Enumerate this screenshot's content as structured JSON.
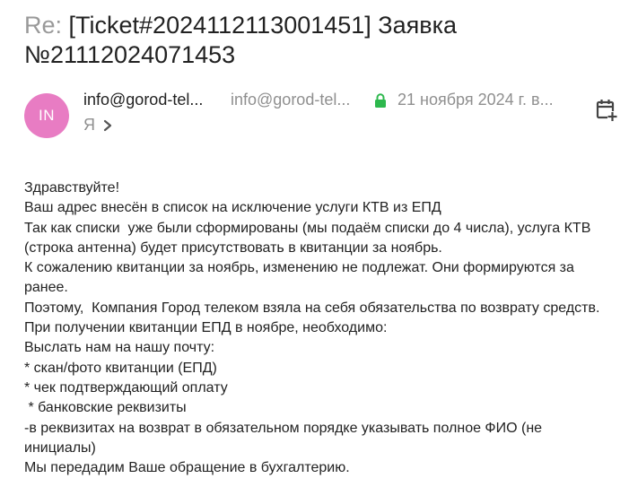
{
  "email": {
    "subject_prefix": "Re:",
    "subject_rest": " [Ticket#2024112113001451] Заявка №21112024071453",
    "avatar_initials": "IN",
    "sender_name": "info@gorod-tel...",
    "sender_email": "info@gorod-tel...",
    "date": "21 ноября 2024 г. в...",
    "recipient": "Я",
    "icons": {
      "lock": "lock-icon",
      "chevron": "chevron-right-icon",
      "calendar": "calendar-add-icon"
    },
    "colors": {
      "avatar_bg": "#e87cc3",
      "lock_green": "#2db84d",
      "muted_text": "#8f8f8f"
    },
    "body_lines": [
      "Здравствуйте!",
      "Ваш адрес внесён в список на исключение услуги КТВ из ЕПД",
      "Так как списки  уже были сформированы (мы подаём списки до 4 числа), услуга КТВ",
      "(строка антенна) будет присутствовать в квитанции за ноябрь.",
      "К сожалению квитанции за ноябрь, изменению не подлежат. Они формируются за",
      "ранее.",
      "Поэтому,  Компания Город телеком взяла на себя обязательства по возврату средств.",
      "При получении квитанции ЕПД в ноябре, необходимо:",
      "Выслать нам на нашу почту:",
      "* скан/фото квитанции (ЕПД)",
      "* чек подтверждающий оплату",
      " * банковские реквизиты",
      "-в реквизитах на возврат в обязательном порядке указывать полное ФИО (не",
      "инициалы)",
      "Мы передадим Ваше обращение в бухгалтерию."
    ]
  }
}
